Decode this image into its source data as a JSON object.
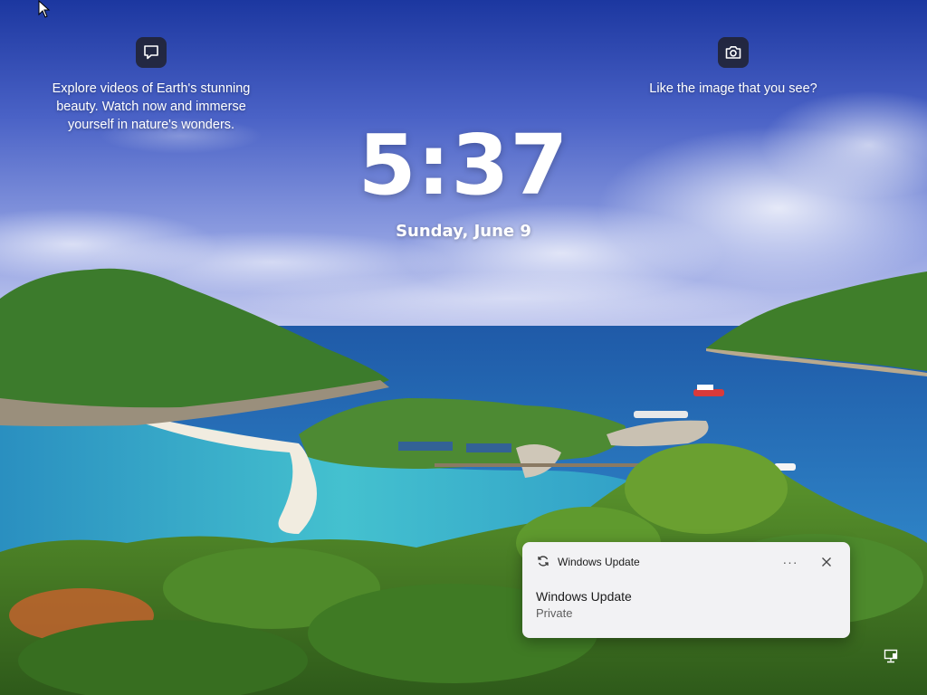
{
  "spotlight": {
    "info_text": "Explore videos of Earth's stunning beauty. Watch now and immerse yourself in nature's wonders.",
    "info_icon": "message-bubble-icon",
    "like_text": "Like the image that you see?",
    "like_icon": "camera-icon"
  },
  "lock": {
    "time": "5:37",
    "date": "Sunday, June 9"
  },
  "toast": {
    "app_name": "Windows Update",
    "app_icon": "sync-icon",
    "more_label": "···",
    "close_icon": "close-icon",
    "title": "Windows Update",
    "body": "Private"
  },
  "tray": {
    "network_icon": "network-icon"
  },
  "colors": {
    "sky_top": "#1f3fa8",
    "sky_mid": "#5a74d0",
    "sea": "#2f7fc4",
    "lagoon": "#3bb2c9",
    "forest": "#3f7a2a",
    "toast_bg": "#f2f2f4"
  }
}
